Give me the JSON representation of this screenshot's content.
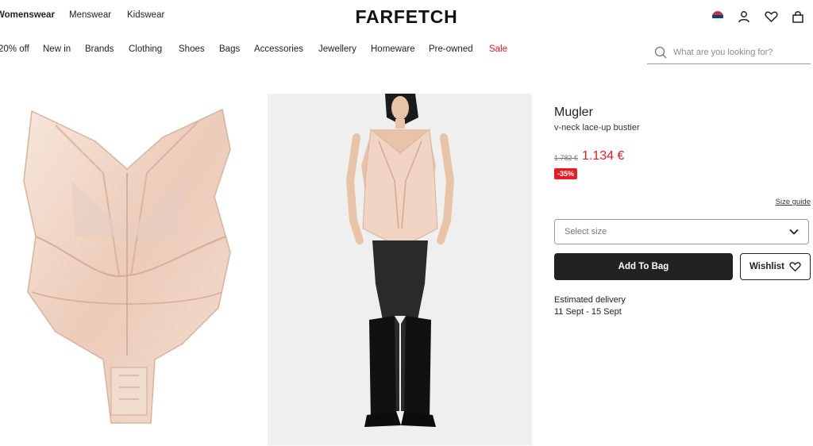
{
  "departments": [
    {
      "label": "Womenswear",
      "active": true
    },
    {
      "label": "Menswear",
      "active": false
    },
    {
      "label": "Kidswear",
      "active": false
    }
  ],
  "logo": "FARFETCH",
  "header_icons": [
    "serbia-flag-icon",
    "account-icon",
    "wishlist-heart-icon",
    "shopping-bag-icon"
  ],
  "nav": [
    "20% off",
    "New in",
    "Brands",
    "Clothing",
    "Shoes",
    "Bags",
    "Accessories",
    "Jewellery",
    "Homeware",
    "Pre-owned",
    "Sale"
  ],
  "search": {
    "placeholder": "What are you looking for?"
  },
  "product": {
    "brand": "Mugler",
    "name": "v-neck lace-up bustier",
    "old_price": "1.782 €",
    "price": "1.134 €",
    "discount": "-35%",
    "size_guide": "Size guide",
    "size_select": "Select size",
    "add_to_bag": "Add To Bag",
    "wishlist": "Wishlist",
    "delivery_label": "Estimated delivery",
    "delivery_dates": "11 Sept - 15 Sept"
  },
  "colors": {
    "sale": "#e21d24",
    "primary_button": "#222222"
  }
}
